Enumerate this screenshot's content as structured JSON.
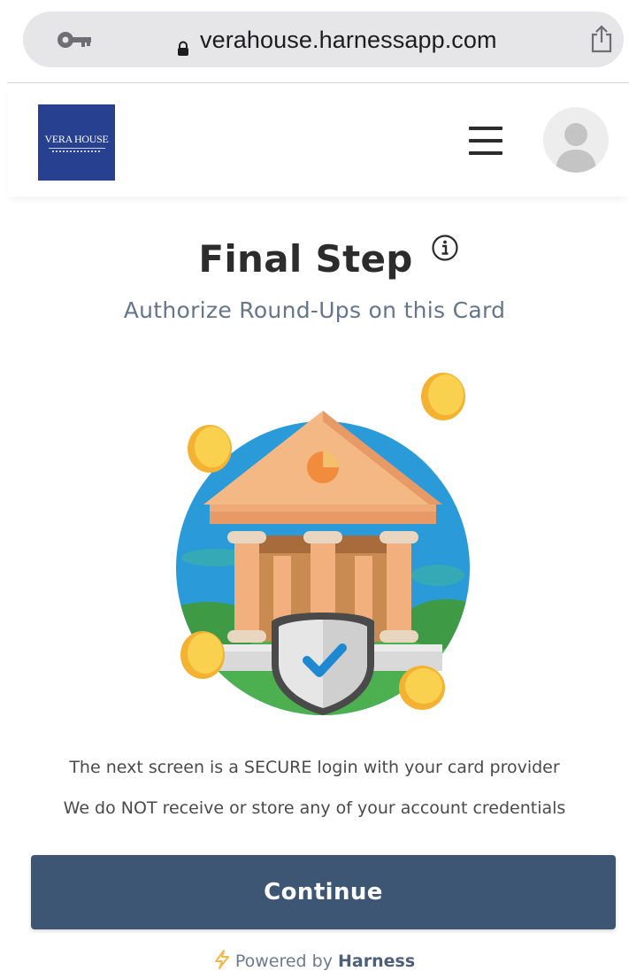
{
  "browser": {
    "url": "verahouse.harnessapp.com"
  },
  "header": {
    "logo_text": "VERA HOUSE",
    "menu_icon": "hamburger-menu-icon",
    "avatar_icon": "user-avatar-icon"
  },
  "main": {
    "title": "Final Step",
    "subtitle": "Authorize Round-Ups on this Card",
    "notes": [
      "The next screen is a SECURE login with your card provider",
      "We do NOT receive or store any of your account credentials"
    ],
    "continue_label": "Continue"
  },
  "footer": {
    "powered_prefix": "Powered by",
    "powered_brand": "Harness"
  },
  "colors": {
    "logo_bg": "#27408f",
    "button_bg": "#3d5674",
    "subtitle": "#65758b",
    "bolt": "#f2b84b"
  }
}
